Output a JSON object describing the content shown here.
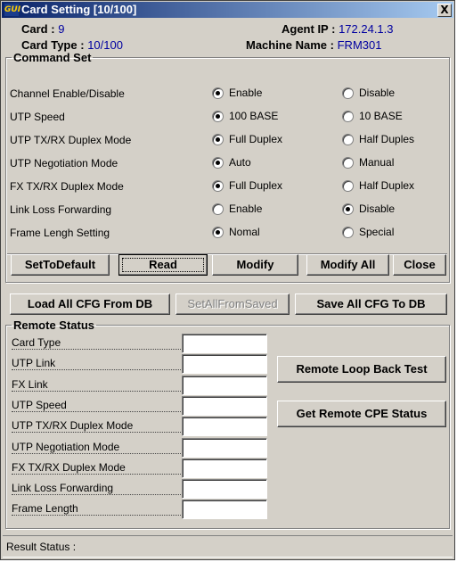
{
  "window": {
    "title": "Card Setting [10/100]",
    "icon_text": "GUI",
    "close_glyph": "X"
  },
  "info": {
    "card_label": "Card :",
    "card_value": "9",
    "card_type_label": "Card Type :",
    "card_type_value": "10/100",
    "agent_ip_label": "Agent IP :",
    "agent_ip_value": "172.24.1.3",
    "machine_name_label": "Machine Name :",
    "machine_name_value": "FRM301"
  },
  "command_set": {
    "legend": "Command  Set",
    "rows": [
      {
        "label": "Channel Enable/Disable",
        "opt1": "Enable",
        "opt2": "Disable",
        "selected": 1
      },
      {
        "label": "UTP Speed",
        "opt1": "100 BASE",
        "opt2": "10 BASE",
        "selected": 1
      },
      {
        "label": "UTP TX/RX Duplex Mode",
        "opt1": "Full Duplex",
        "opt2": "Half Duples",
        "selected": 1
      },
      {
        "label": "UTP Negotiation Mode",
        "opt1": "Auto",
        "opt2": "Manual",
        "selected": 1
      },
      {
        "label": "FX TX/RX Duplex Mode",
        "opt1": "Full Duplex",
        "opt2": "Half Duplex",
        "selected": 1
      },
      {
        "label": "Link Loss Forwarding",
        "opt1": "Enable",
        "opt2": "Disable",
        "selected": 2
      },
      {
        "label": "Frame Lengh Setting",
        "opt1": "Nomal",
        "opt2": "Special",
        "selected": 1
      }
    ],
    "buttons": {
      "set_to_default": "SetToDefault",
      "read": "Read",
      "modify": "Modify",
      "modify_all": "Modify All",
      "close": "Close"
    }
  },
  "db_buttons": {
    "load_all": "Load All CFG From DB",
    "set_all_from_saved": "SetAllFromSaved",
    "save_all": "Save All CFG To DB"
  },
  "remote_status": {
    "legend": "Remote Status",
    "fields": [
      {
        "label": "Card Type",
        "value": ""
      },
      {
        "label": "UTP Link",
        "value": ""
      },
      {
        "label": "FX   Link",
        "value": ""
      },
      {
        "label": "UTP Speed",
        "value": ""
      },
      {
        "label": "UTP TX/RX Duplex Mode",
        "value": ""
      },
      {
        "label": "UTP Negotiation Mode",
        "value": ""
      },
      {
        "label": "FX TX/RX Duplex Mode",
        "value": ""
      },
      {
        "label": "Link Loss Forwarding",
        "value": ""
      },
      {
        "label": "Frame Length",
        "value": ""
      }
    ],
    "remote_loop_back_test": "Remote Loop Back Test",
    "get_remote_cpe_status": "Get Remote CPE Status"
  },
  "status_bar": {
    "label": "Result Status :",
    "value": ""
  }
}
